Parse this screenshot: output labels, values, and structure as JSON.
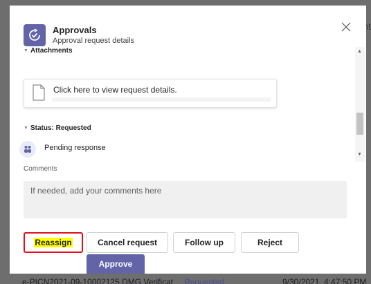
{
  "background": {
    "right_text": "nt",
    "row": {
      "name": "e-PICN2021-09-10002125 DMG Verificat",
      "status": "Requested",
      "datetime": "9/30/2021, 4:47:50 PM"
    }
  },
  "dialog": {
    "app_title": "Approvals",
    "app_subtitle": "Approval request details",
    "close_icon": "close-icon"
  },
  "attachments": {
    "header": "Attachments",
    "card_text": "Click here to view request details."
  },
  "status": {
    "header": "Status: Requested",
    "pending_text": "Pending response"
  },
  "comments": {
    "label": "Comments",
    "placeholder": "If needed, add your comments here"
  },
  "actions": {
    "reassign": "Reassign",
    "cancel": "Cancel request",
    "follow_up": "Follow up",
    "reject": "Reject",
    "approve": "Approve"
  },
  "colors": {
    "accent": "#6264a7",
    "highlight": "#ffff00",
    "outline": "#e0101c"
  }
}
